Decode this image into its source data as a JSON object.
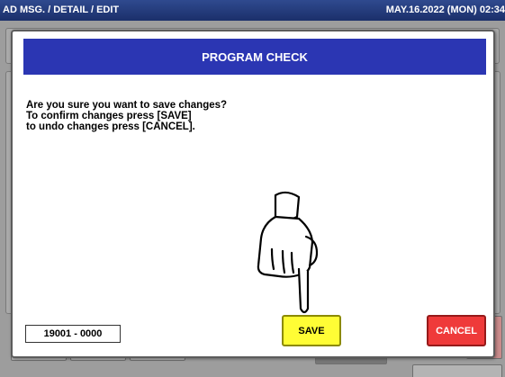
{
  "header": {
    "breadcrumb": "AD MSG. / DETAIL / EDIT",
    "datetime": "MAY.16.2022 (MON) 02:34"
  },
  "dialog": {
    "title": "PROGRAM CHECK",
    "message_lines": [
      "Are you sure you want to save changes?",
      "To confirm changes press [SAVE]",
      "to undo changes press [CANCEL]."
    ],
    "code": "19001 - 0000",
    "save_label": "SAVE",
    "cancel_label": "CANCEL"
  },
  "icons": {
    "pointer": "pointing-hand-icon"
  },
  "colors": {
    "title_bar": "#2b36b3",
    "save_button": "#fffd35",
    "cancel_button": "#ef3a3a",
    "header_bar": "#1b2f6a"
  }
}
